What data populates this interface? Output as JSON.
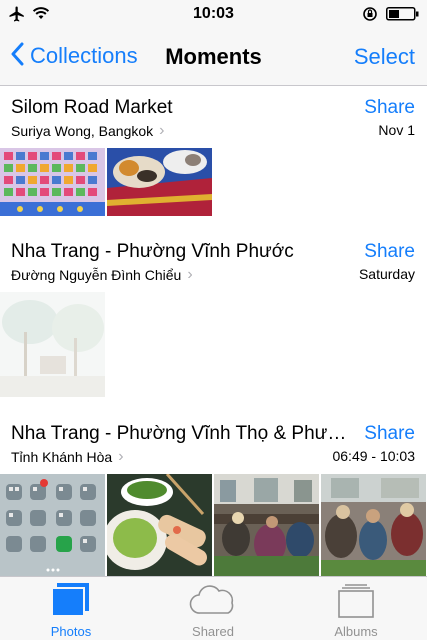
{
  "status_bar": {
    "time": "10:03",
    "icons": [
      "airplane-icon",
      "wifi-icon",
      "orientation-lock-icon",
      "battery-icon"
    ]
  },
  "nav": {
    "back_label": "Collections",
    "title": "Moments",
    "action_label": "Select"
  },
  "moments": [
    {
      "title": "Silom Road Market",
      "subtitle": "Suriya Wong, Bangkok",
      "date": "Nov 1",
      "share_label": "Share",
      "photos": [
        "alphabet-chart-photo",
        "sleeping-cat-photo"
      ]
    },
    {
      "title": "Nha Trang - Phường Vĩnh Phước",
      "subtitle": "Đường Nguyễn Đình Chiểu",
      "date": "Saturday",
      "share_label": "Share",
      "photos": [
        "overexposed-trees-photo"
      ]
    },
    {
      "title": "Nha Trang - Phường Vĩnh Thọ & Phư…",
      "subtitle": "Tỉnh Khánh Hòa",
      "date": "06:49 - 10:03",
      "share_label": "Share",
      "photos": [
        "home-screen-photo",
        "spring-rolls-photo",
        "market-stalls-photo",
        "market-crowd-photo"
      ]
    }
  ],
  "tabs": [
    {
      "label": "Photos",
      "icon": "photos-tab-icon",
      "active": true
    },
    {
      "label": "Shared",
      "icon": "cloud-icon",
      "active": false
    },
    {
      "label": "Albums",
      "icon": "albums-icon",
      "active": false
    }
  ],
  "colors": {
    "accent": "#157efb",
    "bar_background": "#f7f7f7",
    "inactive_tab": "#929292"
  }
}
